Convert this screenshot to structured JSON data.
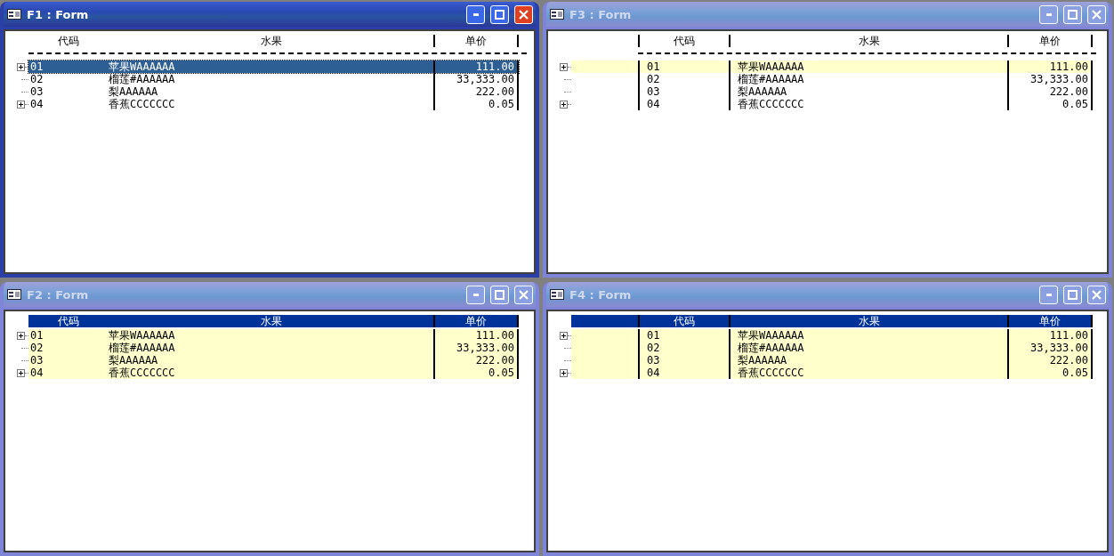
{
  "windows": [
    {
      "title": "F1 : Form",
      "active": true,
      "header_filled": false,
      "indent_column": false,
      "rows_tinted": false,
      "columns": [
        "代码",
        "水果",
        "单价"
      ],
      "rows": [
        {
          "code": "01",
          "fruit": "苹果WAAAAAA",
          "price": "111.00",
          "expandable": true,
          "selected": true
        },
        {
          "code": "02",
          "fruit": "榴莲#AAAAAA",
          "price": "33,333.00",
          "expandable": false,
          "selected": false
        },
        {
          "code": "03",
          "fruit": "梨AAAAAA",
          "price": "222.00",
          "expandable": false,
          "selected": false
        },
        {
          "code": "04",
          "fruit": "香蕉CCCCCCC",
          "price": "0.05",
          "expandable": true,
          "selected": false
        }
      ]
    },
    {
      "title": "F3 : Form",
      "active": false,
      "header_filled": false,
      "indent_column": true,
      "rows_tinted": false,
      "columns": [
        "代码",
        "水果",
        "单价"
      ],
      "rows": [
        {
          "code": "01",
          "fruit": "苹果WAAAAAA",
          "price": "111.00",
          "expandable": true,
          "selected": true
        },
        {
          "code": "02",
          "fruit": "榴莲#AAAAAA",
          "price": "33,333.00",
          "expandable": false,
          "selected": false
        },
        {
          "code": "03",
          "fruit": "梨AAAAAA",
          "price": "222.00",
          "expandable": false,
          "selected": false
        },
        {
          "code": "04",
          "fruit": "香蕉CCCCCCC",
          "price": "0.05",
          "expandable": true,
          "selected": false
        }
      ]
    },
    {
      "title": "F2 : Form",
      "active": false,
      "header_filled": true,
      "indent_column": false,
      "rows_tinted": true,
      "columns": [
        "代码",
        "水果",
        "单价"
      ],
      "rows": [
        {
          "code": "01",
          "fruit": "苹果WAAAAAA",
          "price": "111.00",
          "expandable": true,
          "selected": false
        },
        {
          "code": "02",
          "fruit": "榴莲#AAAAAA",
          "price": "33,333.00",
          "expandable": false,
          "selected": false
        },
        {
          "code": "03",
          "fruit": "梨AAAAAA",
          "price": "222.00",
          "expandable": false,
          "selected": false
        },
        {
          "code": "04",
          "fruit": "香蕉CCCCCCC",
          "price": "0.05",
          "expandable": true,
          "selected": false
        }
      ]
    },
    {
      "title": "F4 : Form",
      "active": false,
      "header_filled": true,
      "indent_column": true,
      "rows_tinted": true,
      "columns": [
        "代码",
        "水果",
        "单价"
      ],
      "rows": [
        {
          "code": "01",
          "fruit": "苹果WAAAAAA",
          "price": "111.00",
          "expandable": true,
          "selected": false
        },
        {
          "code": "02",
          "fruit": "榴莲#AAAAAA",
          "price": "33,333.00",
          "expandable": false,
          "selected": false
        },
        {
          "code": "03",
          "fruit": "梨AAAAAA",
          "price": "222.00",
          "expandable": false,
          "selected": false
        },
        {
          "code": "04",
          "fruit": "香蕉CCCCCCC",
          "price": "0.05",
          "expandable": true,
          "selected": false
        }
      ]
    }
  ]
}
